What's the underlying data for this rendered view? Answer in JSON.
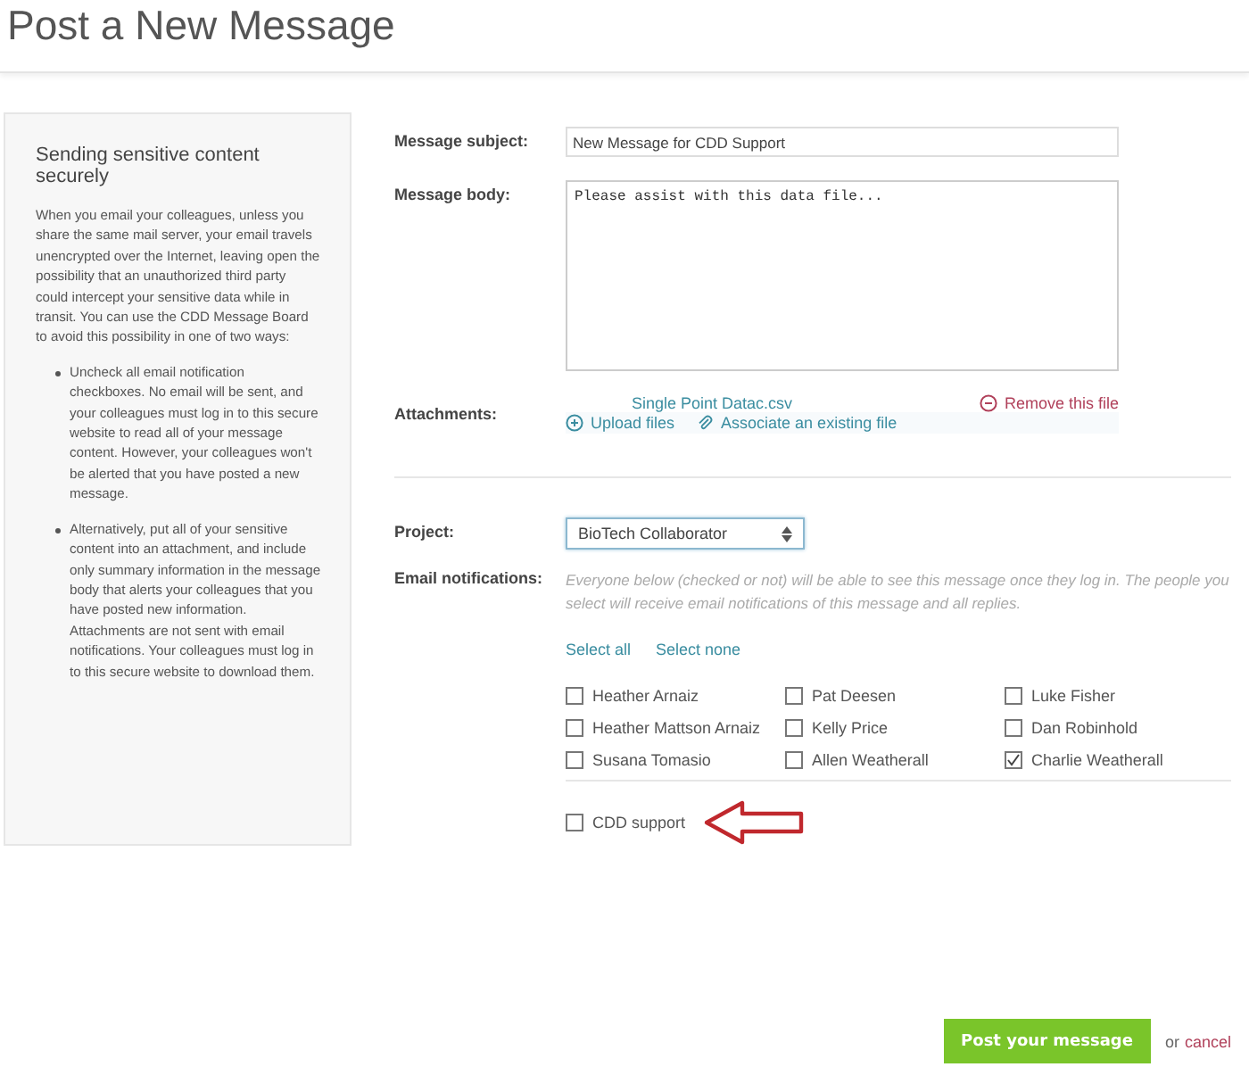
{
  "page_title": "Post a New Message",
  "sidebar": {
    "heading": "Sending sensitive content securely",
    "intro": "When you email your colleagues, unless you share the same mail server, your email travels unencrypted over the Internet, leaving open the possibility that an unauthorized third party could intercept your sensitive data while in transit. You can use the CDD Message Board to avoid this possibility in one of two ways:",
    "bullets": [
      "Uncheck all email notification checkboxes. No email will be sent, and your colleagues must log in to this secure website to read all of your message content. However, your colleagues won't be alerted that you have posted a new message.",
      "Alternatively, put all of your sensitive content into an attachment, and include only summary information in the message body that alerts your colleagues that you have posted new information. Attachments are not sent with email notifications. Your colleagues must log in to this secure website to download them."
    ]
  },
  "subject": {
    "label": "Message subject:",
    "value": "New Message for CDD Support"
  },
  "body": {
    "label": "Message body:",
    "value": "Please assist with this data file..."
  },
  "attachments": {
    "label": "Attachments:",
    "file": "Single Point Datac.csv",
    "remove": "Remove this file",
    "upload": "Upload files",
    "associate": "Associate an existing file"
  },
  "project": {
    "label": "Project:",
    "value": "BioTech Collaborator"
  },
  "notifications": {
    "label": "Email notifications:",
    "hint": "Everyone below (checked or not) will be able to see this message once they log in. The people you select will receive email notifications of this message and all replies.",
    "select_all": "Select all",
    "select_none": "Select none",
    "recipients": [
      {
        "name": "Heather Arnaiz",
        "checked": false
      },
      {
        "name": "Pat Deesen",
        "checked": false
      },
      {
        "name": "Luke Fisher",
        "checked": false
      },
      {
        "name": "Heather Mattson Arnaiz",
        "checked": false
      },
      {
        "name": "Kelly Price",
        "checked": false
      },
      {
        "name": "Dan Robinhold",
        "checked": false
      },
      {
        "name": "Susana Tomasio",
        "checked": false
      },
      {
        "name": "Allen Weatherall",
        "checked": false
      },
      {
        "name": "Charlie Weatherall",
        "checked": true
      }
    ],
    "extra_recipients": [
      {
        "name": "CDD support",
        "checked": false
      }
    ]
  },
  "actions": {
    "submit": "Post your message",
    "or": "or",
    "cancel": "cancel"
  }
}
